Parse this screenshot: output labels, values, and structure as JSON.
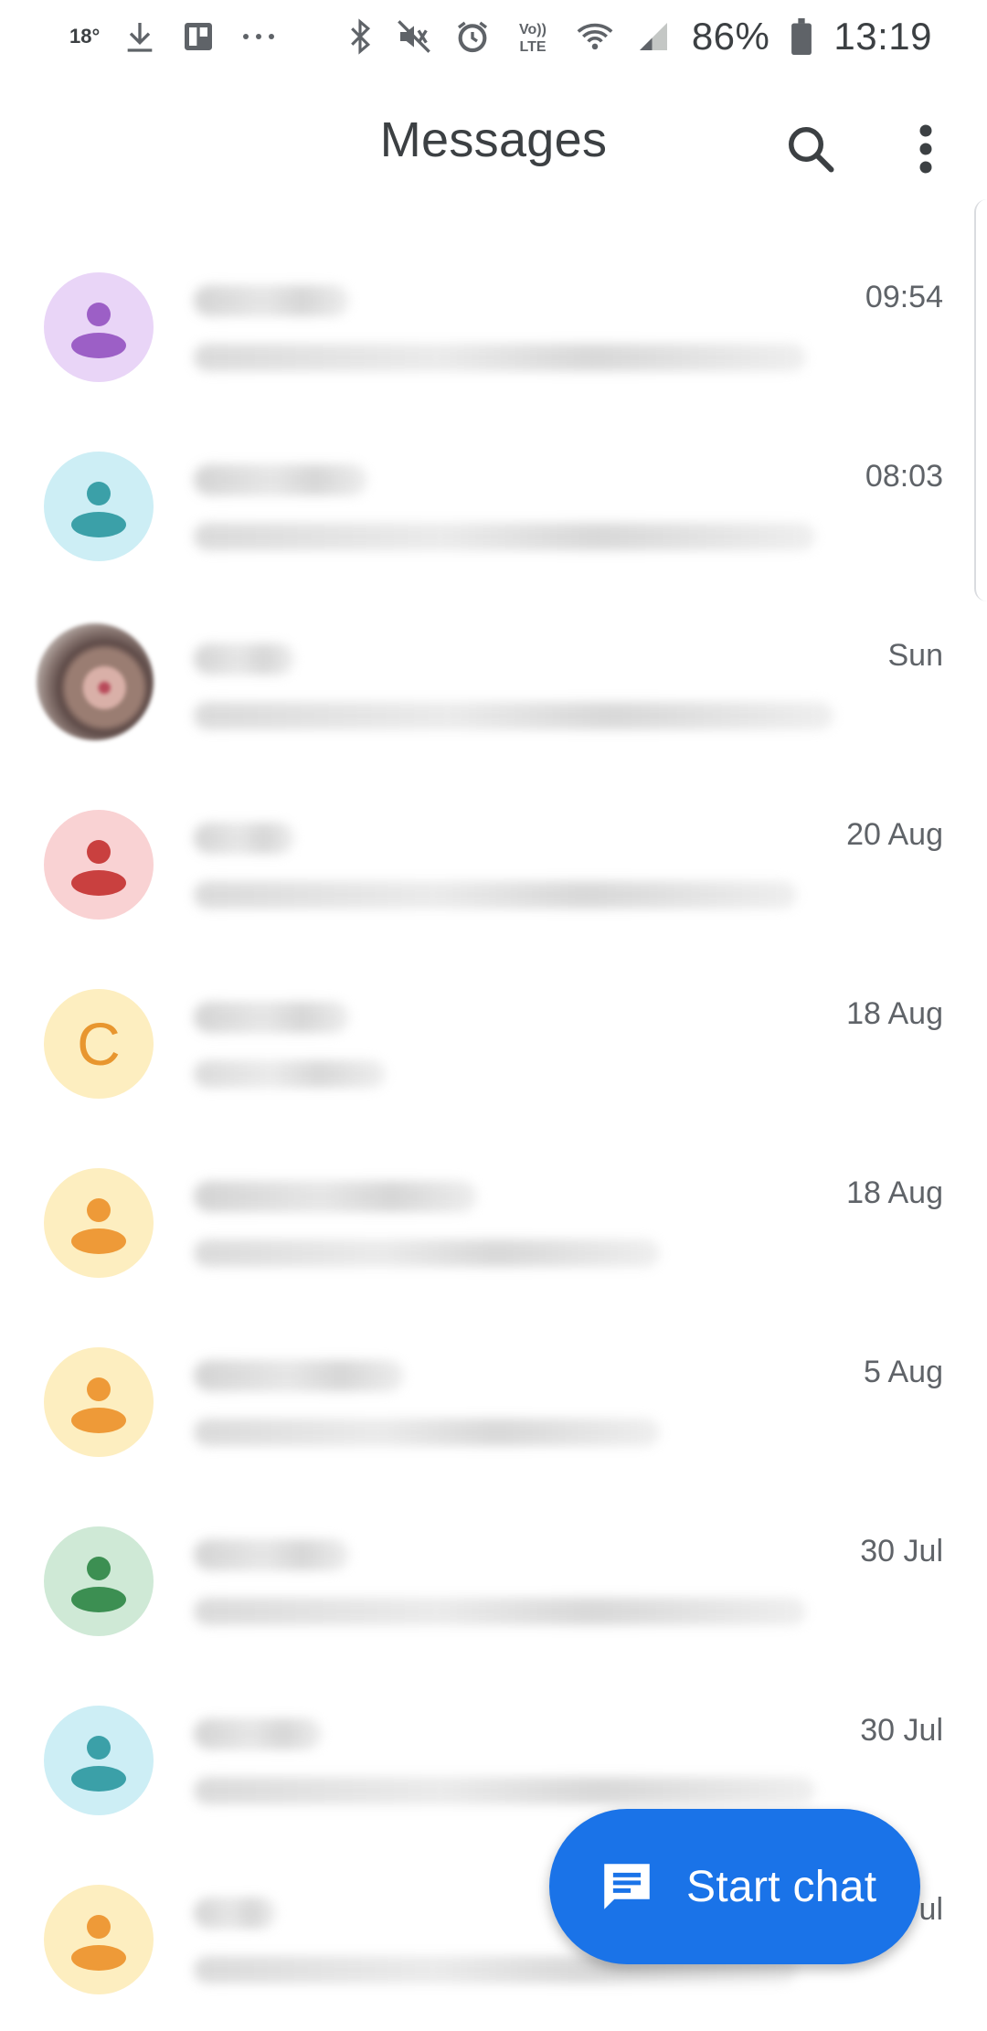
{
  "status_bar": {
    "temperature": "18°",
    "left_icons": [
      "download-icon",
      "board-icon",
      "more-horizontal-icon"
    ],
    "right_icons": [
      "bluetooth-icon",
      "mute-icon",
      "alarm-icon",
      "volte-icon",
      "wifi-icon",
      "signal-icon",
      "battery-icon"
    ],
    "volte_label": "Vo)) LTE",
    "battery": "86%",
    "time": "13:19"
  },
  "app_bar": {
    "title": "Messages",
    "search_icon": "search-icon",
    "menu_icon": "more-vertical-icon"
  },
  "conversations": [
    {
      "time": "09:54",
      "avatar": "person",
      "avatar_bg": "#e9d5f7",
      "avatar_fg": "#9c5fc6"
    },
    {
      "time": "08:03",
      "avatar": "person",
      "avatar_bg": "#cdeef5",
      "avatar_fg": "#3ba0a8"
    },
    {
      "time": "Sun",
      "avatar": "photo"
    },
    {
      "time": "20 Aug",
      "avatar": "person",
      "avatar_bg": "#f9d2d3",
      "avatar_fg": "#c9403f"
    },
    {
      "time": "18 Aug",
      "avatar": "letter",
      "avatar_letter": "C",
      "avatar_bg": "#fdeec0",
      "avatar_fg": "#e8962f"
    },
    {
      "time": "18 Aug",
      "avatar": "person",
      "avatar_bg": "#fdeec0",
      "avatar_fg": "#ee9a38"
    },
    {
      "time": "5 Aug",
      "avatar": "person",
      "avatar_bg": "#fdeec0",
      "avatar_fg": "#ee9a38"
    },
    {
      "time": "30 Jul",
      "avatar": "person",
      "avatar_bg": "#cfe9d6",
      "avatar_fg": "#3c8f52"
    },
    {
      "time": "30 Jul",
      "avatar": "person",
      "avatar_bg": "#cdeef5",
      "avatar_fg": "#3ba0a8"
    },
    {
      "time": "ul",
      "avatar": "person",
      "avatar_bg": "#fdeec0",
      "avatar_fg": "#ee9a38"
    }
  ],
  "fab": {
    "label": "Start chat",
    "icon": "chat-icon",
    "color": "#1a73e8"
  }
}
